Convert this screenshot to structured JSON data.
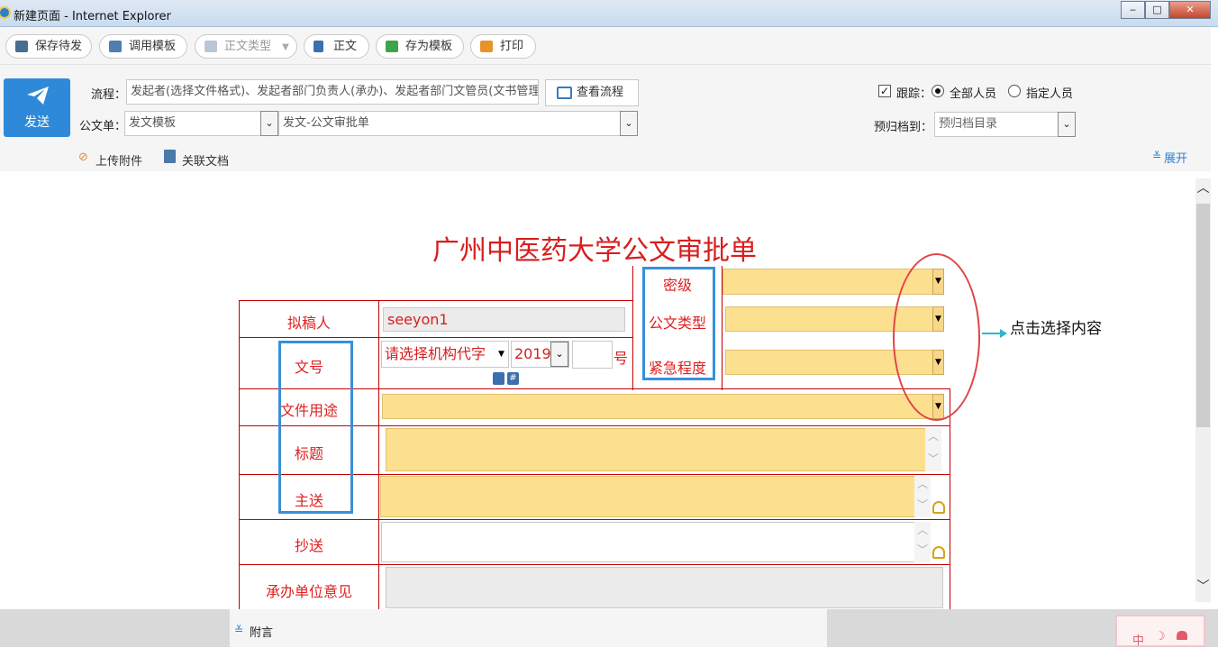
{
  "window": {
    "title": "新建页面 - Internet Explorer",
    "buttons": {
      "minimize": "‒",
      "maximize": "□",
      "close": "✕"
    }
  },
  "toolbar": [
    {
      "label": "保存待发",
      "icon": "save-icon",
      "disabled": false
    },
    {
      "label": "调用模板",
      "icon": "template-icon",
      "disabled": false
    },
    {
      "label": "正文类型",
      "icon": "doc-type-icon",
      "disabled": true
    },
    {
      "label": "正文",
      "icon": "document-icon",
      "disabled": false
    },
    {
      "label": "存为模板",
      "icon": "save-template-icon",
      "disabled": false
    },
    {
      "label": "打印",
      "icon": "print-icon",
      "disabled": false
    }
  ],
  "send_button": {
    "label": "发送"
  },
  "flow": {
    "label": "流程：",
    "value": "发起者(选择文件格式)、发起者部门负责人(承办)、发起者部门文管员(文书管理)、",
    "view_button": "查看流程"
  },
  "doc_form": {
    "label": "公文单：",
    "template": "发文模板",
    "form": "发文-公文审批单"
  },
  "tracking": {
    "label": "跟踪：",
    "checked": true,
    "options": [
      "全部人员",
      "指定人员"
    ],
    "selected": "全部人员"
  },
  "archive": {
    "label": "预归档到：",
    "placeholder": "预归档目录"
  },
  "attachments": {
    "upload": "上传附件",
    "related": "关联文档",
    "expand": "展开"
  },
  "form": {
    "title": "广州中医药大学公文审批单",
    "labels": {
      "secret_level": "密级",
      "drafter": "拟稿人",
      "doc_type": "公文类型",
      "doc_number": "文号",
      "urgency": "紧急程度",
      "purpose": "文件用途",
      "subject": "标题",
      "main_recipient": "主送",
      "cc": "抄送",
      "dept_opinion": "承办单位意见"
    },
    "drafter_value": "seeyon1",
    "doc_number": {
      "org_placeholder": "请选择机构代字",
      "year": "2019",
      "suffix": "号"
    }
  },
  "annotation": {
    "text": "点击选择内容"
  },
  "footer": {
    "label": "附言"
  },
  "ime": {
    "lang": "中",
    "moon": "☽"
  }
}
